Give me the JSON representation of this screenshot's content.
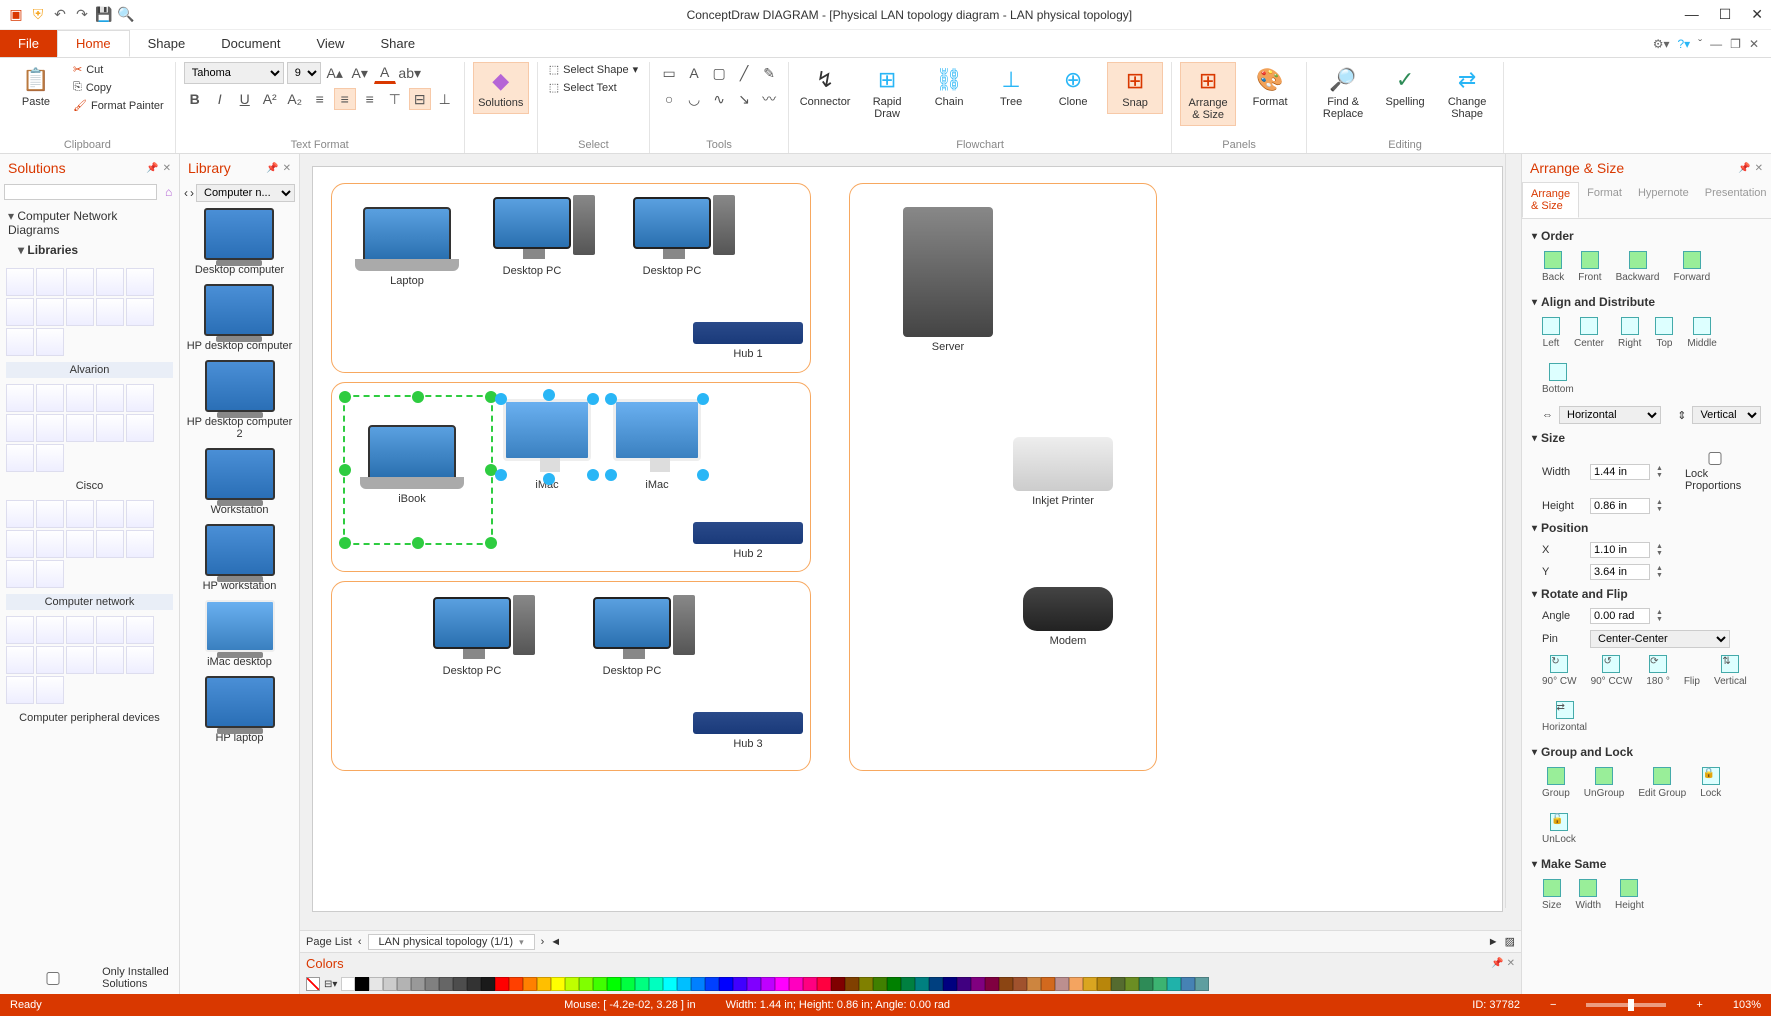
{
  "app": {
    "title": "ConceptDraw DIAGRAM - [Physical LAN topology diagram - LAN physical topology]"
  },
  "tabs": {
    "file": "File",
    "home": "Home",
    "shape": "Shape",
    "document": "Document",
    "view": "View",
    "share": "Share"
  },
  "ribbon": {
    "clipboard": {
      "paste": "Paste",
      "cut": "Cut",
      "copy": "Copy",
      "fmt": "Format Painter",
      "label": "Clipboard"
    },
    "textfmt": {
      "font": "Tahoma",
      "size": "9",
      "label": "Text Format"
    },
    "solutions": {
      "label": "Solutions",
      "btn": "Solutions"
    },
    "select": {
      "selshape": "Select Shape",
      "seltext": "Select Text",
      "label": "Select"
    },
    "tools": {
      "label": "Tools"
    },
    "flowchart": {
      "connector": "Connector",
      "rapid": "Rapid Draw",
      "chain": "Chain",
      "tree": "Tree",
      "clone": "Clone",
      "snap": "Snap",
      "arrange": "Arrange & Size",
      "format": "Format",
      "label": "Flowchart"
    },
    "panels": {
      "label": "Panels"
    },
    "editing": {
      "find": "Find & Replace",
      "spelling": "Spelling",
      "chshape": "Change Shape",
      "label": "Editing"
    }
  },
  "solpanel": {
    "title": "Solutions",
    "root": "Computer Network Diagrams",
    "libs": "Libraries",
    "cats": [
      "Alvarion",
      "Cisco",
      "Computer network",
      "Computer peripheral devices"
    ],
    "only": "Only Installed Solutions"
  },
  "libpanel": {
    "title": "Library",
    "combo": "Computer n...",
    "items": [
      "Desktop computer",
      "HP desktop computer",
      "HP desktop computer 2",
      "Workstation",
      "HP workstation",
      "iMac desktop",
      "HP laptop"
    ]
  },
  "canvas": {
    "devices": {
      "laptop": "Laptop",
      "dpc1": "Desktop PC",
      "dpc2": "Desktop PC",
      "hub1": "Hub 1",
      "ibook": "iBook",
      "imac1": "iMac",
      "imac2": "iMac",
      "hub2": "Hub 2",
      "dpc3": "Desktop PC",
      "dpc4": "Desktop PC",
      "hub3": "Hub 3",
      "server": "Server",
      "printer": "Inkjet Printer",
      "modem": "Modem"
    },
    "pagelist": "Page List",
    "pagetab": "LAN physical topology (1/1)"
  },
  "colors": {
    "label": "Colors"
  },
  "arr": {
    "title": "Arrange & Size",
    "tabs": [
      "Arrange & Size",
      "Format",
      "Hypernote",
      "Presentation"
    ],
    "order": {
      "h": "Order",
      "back": "Back",
      "front": "Front",
      "backward": "Backward",
      "forward": "Forward"
    },
    "align": {
      "h": "Align and Distribute",
      "left": "Left",
      "center": "Center",
      "right": "Right",
      "top": "Top",
      "middle": "Middle",
      "bottom": "Bottom",
      "horiz": "Horizontal",
      "vert": "Vertical"
    },
    "size": {
      "h": "Size",
      "wl": "Width",
      "wv": "1.44 in",
      "hl": "Height",
      "hv": "0.86 in",
      "lock": "Lock Proportions"
    },
    "pos": {
      "h": "Position",
      "xl": "X",
      "xv": "1.10 in",
      "yl": "Y",
      "yv": "3.64 in"
    },
    "rot": {
      "h": "Rotate and Flip",
      "al": "Angle",
      "av": "0.00 rad",
      "pl": "Pin",
      "pv": "Center-Center",
      "cw": "90° CW",
      "ccw": "90° CCW",
      "r180": "180 °",
      "flip": "Flip",
      "fv": "Vertical",
      "fh": "Horizontal"
    },
    "grp": {
      "h": "Group and Lock",
      "g": "Group",
      "ug": "UnGroup",
      "eg": "Edit Group",
      "lk": "Lock",
      "ul": "UnLock"
    },
    "same": {
      "h": "Make Same",
      "s": "Size",
      "w": "Width",
      "ht": "Height"
    }
  },
  "status": {
    "ready": "Ready",
    "mouse": "Mouse: [ -4.2e-02, 3.28 ] in",
    "dims": "Width: 1.44 in;  Height: 0.86 in;  Angle: 0.00 rad",
    "id": "ID: 37782",
    "zoom": "103%"
  },
  "swatches": [
    "#fff",
    "#000",
    "#e6e6e6",
    "#ccc",
    "#b3b3b3",
    "#999",
    "#808080",
    "#666",
    "#4d4d4d",
    "#333",
    "#1a1a1a",
    "#f00",
    "#ff4000",
    "#ff8000",
    "#ffbf00",
    "#ff0",
    "#bfff00",
    "#80ff00",
    "#40ff00",
    "#0f0",
    "#00ff40",
    "#00ff80",
    "#00ffbf",
    "#0ff",
    "#00bfff",
    "#0080ff",
    "#0040ff",
    "#00f",
    "#4000ff",
    "#8000ff",
    "#bf00ff",
    "#f0f",
    "#ff00bf",
    "#ff0080",
    "#ff0040",
    "#800000",
    "#804000",
    "#808000",
    "#408000",
    "#008000",
    "#008040",
    "#008080",
    "#004080",
    "#000080",
    "#400080",
    "#800080",
    "#800040",
    "#8b4513",
    "#a0522d",
    "#cd853f",
    "#d2691e",
    "#bc8f8f",
    "#f4a460",
    "#daa520",
    "#b8860b",
    "#556b2f",
    "#6b8e23",
    "#2e8b57",
    "#3cb371",
    "#20b2aa",
    "#4682b4",
    "#5f9ea0"
  ]
}
